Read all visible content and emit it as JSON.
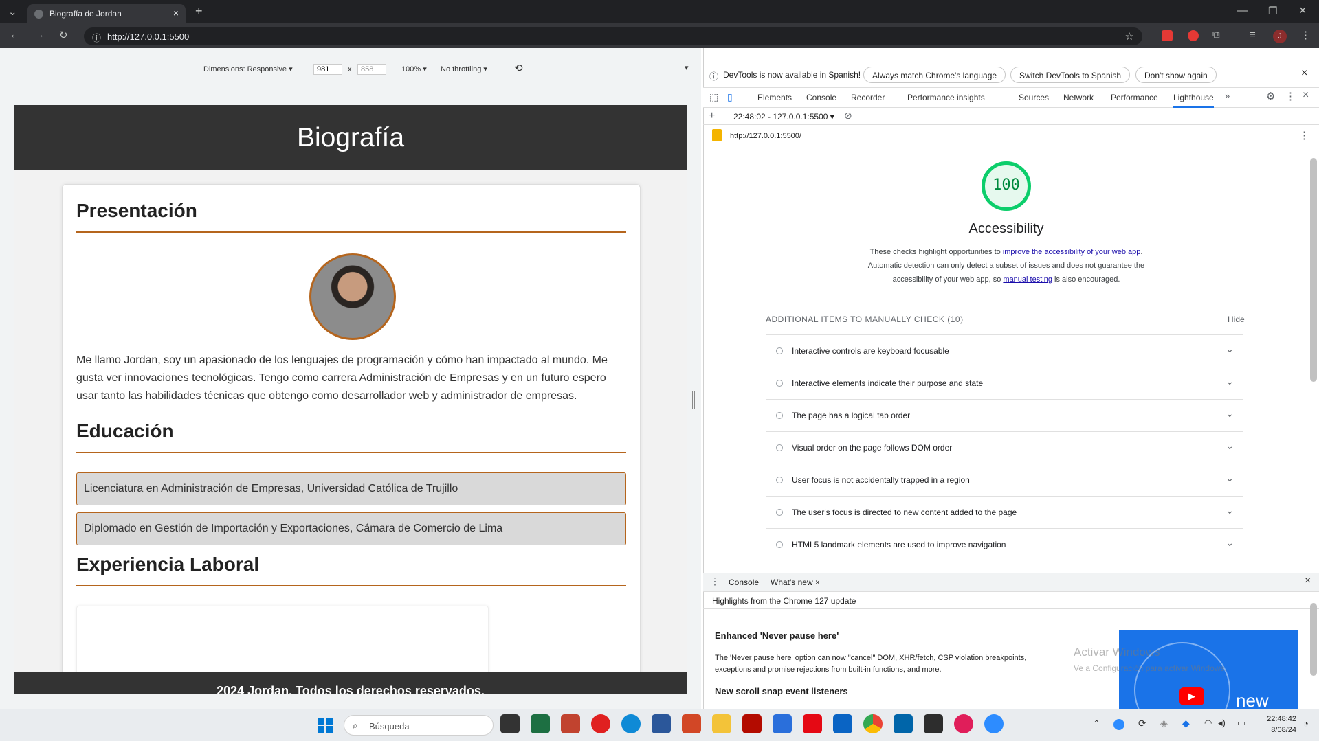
{
  "browser": {
    "tab_title": "Biografía de Jordan",
    "url": "http://127.0.0.1:5500",
    "profile_initial": "J"
  },
  "device_toolbar": {
    "dimensions_label": "Dimensions: Responsive",
    "width": "981",
    "height": "858",
    "times": "x",
    "zoom": "100%",
    "throttling": "No throttling"
  },
  "page": {
    "header_title": "Biografía",
    "presentation_heading": "Presentación",
    "presentation_text": "Me llamo Jordan, soy un apasionado de los lenguajes de programación y cómo han impactado al mundo. Me gusta ver innovaciones tecnológicas. Tengo como carrera Administración de Empresas y en un futuro espero usar tanto las habilidades técnicas que obtengo como desarrollador web y administrador de empresas.",
    "education_heading": "Educación",
    "education_items": [
      "Licenciatura en Administración de Empresas, Universidad Católica de Trujillo",
      "Diplomado en Gestión de Importación y Exportaciones, Cámara de Comercio de Lima"
    ],
    "experience_heading": "Experiencia Laboral",
    "footer_text": "2024 Jordan. Todos los derechos reservados."
  },
  "devtools": {
    "notice": "DevTools is now available in Spanish!",
    "btn_match": "Always match Chrome's language",
    "btn_switch": "Switch DevTools to Spanish",
    "btn_dont": "Don't show again",
    "tabs": [
      "Elements",
      "Console",
      "Recorder",
      "Performance insights",
      "Sources",
      "Network",
      "Performance",
      "Lighthouse"
    ],
    "report_time": "22:48:02 - 127.0.0.1:5500",
    "report_url": "http://127.0.0.1:5500/",
    "score": "100",
    "category": "Accessibility",
    "desc_1": "These checks highlight opportunities to ",
    "desc_link1": "improve the accessibility of your web app",
    "desc_2": ". Automatic detection can only detect a subset of issues and does not guarantee the accessibility of your web app, so ",
    "desc_link2": "manual testing",
    "desc_3": " is also encouraged.",
    "manual_heading": "ADDITIONAL ITEMS TO MANUALLY CHECK (10)",
    "hide": "Hide",
    "items": [
      "Interactive controls are keyboard focusable",
      "Interactive elements indicate their purpose and state",
      "The page has a logical tab order",
      "Visual order on the page follows DOM order",
      "User focus is not accidentally trapped in a region",
      "The user's focus is directed to new content added to the page",
      "HTML5 landmark elements are used to improve navigation"
    ],
    "drawer_tab_console": "Console",
    "drawer_tab_whatsnew": "What's new",
    "whatsnew_highlights": "Highlights from the Chrome 127 update",
    "whatsnew_h1": "Enhanced 'Never pause here'",
    "whatsnew_p1": "The 'Never pause here' option can now \"cancel\" DOM, XHR/fetch, CSP violation breakpoints, exceptions and promise rejections from built-in functions, and more.",
    "whatsnew_h2": "New scroll snap event listeners",
    "video_label": "new",
    "watermark_1": "Activar Windows",
    "watermark_2": "Ve a Configuración para activar Windows."
  },
  "taskbar": {
    "search_placeholder": "Búsqueda",
    "time": "22:48:42",
    "date": "8/08/24"
  },
  "colors": {
    "accent": "#b5651d",
    "score_green": "#0cce6b",
    "header_bg": "#333333"
  }
}
